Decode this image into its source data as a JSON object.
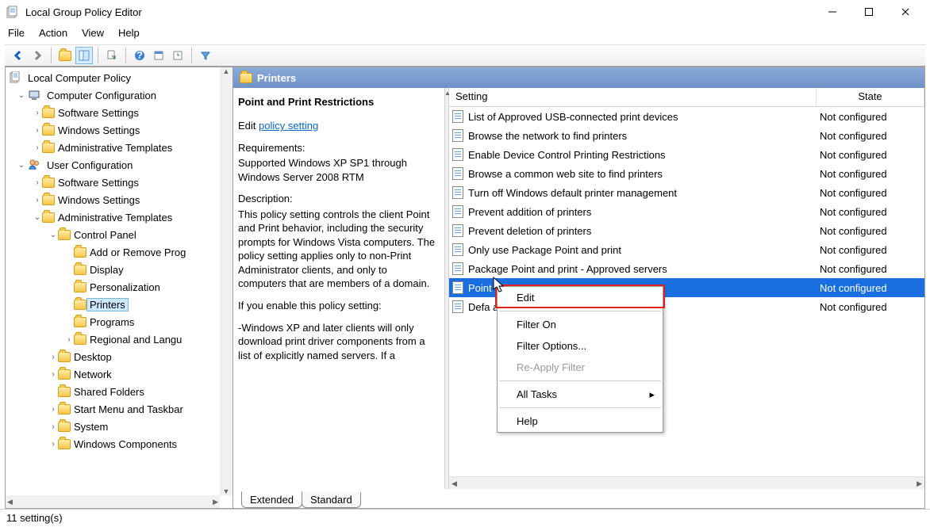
{
  "window": {
    "title": "Local Group Policy Editor"
  },
  "menubar": [
    "File",
    "Action",
    "View",
    "Help"
  ],
  "tree": {
    "root": "Local Computer Policy",
    "items": [
      {
        "depth": 0,
        "exp": "v",
        "icon": "computer",
        "label": "Computer Configuration"
      },
      {
        "depth": 1,
        "exp": ">",
        "icon": "folder",
        "label": "Software Settings"
      },
      {
        "depth": 1,
        "exp": ">",
        "icon": "folder",
        "label": "Windows Settings"
      },
      {
        "depth": 1,
        "exp": ">",
        "icon": "folder",
        "label": "Administrative Templates"
      },
      {
        "depth": 0,
        "exp": "v",
        "icon": "user",
        "label": "User Configuration"
      },
      {
        "depth": 1,
        "exp": ">",
        "icon": "folder",
        "label": "Software Settings"
      },
      {
        "depth": 1,
        "exp": ">",
        "icon": "folder",
        "label": "Windows Settings"
      },
      {
        "depth": 1,
        "exp": "v",
        "icon": "folder",
        "label": "Administrative Templates"
      },
      {
        "depth": 2,
        "exp": "v",
        "icon": "folder",
        "label": "Control Panel"
      },
      {
        "depth": 3,
        "exp": "",
        "icon": "folder",
        "label": "Add or Remove Prog"
      },
      {
        "depth": 3,
        "exp": "",
        "icon": "folder",
        "label": "Display"
      },
      {
        "depth": 3,
        "exp": "",
        "icon": "folder",
        "label": "Personalization"
      },
      {
        "depth": 3,
        "exp": "",
        "icon": "folder",
        "label": "Printers",
        "selected": true
      },
      {
        "depth": 3,
        "exp": "",
        "icon": "folder",
        "label": "Programs"
      },
      {
        "depth": 3,
        "exp": ">",
        "icon": "folder",
        "label": "Regional and Langu"
      },
      {
        "depth": 2,
        "exp": ">",
        "icon": "folder",
        "label": "Desktop"
      },
      {
        "depth": 2,
        "exp": ">",
        "icon": "folder",
        "label": "Network"
      },
      {
        "depth": 2,
        "exp": "",
        "icon": "folder",
        "label": "Shared Folders"
      },
      {
        "depth": 2,
        "exp": ">",
        "icon": "folder",
        "label": "Start Menu and Taskbar"
      },
      {
        "depth": 2,
        "exp": ">",
        "icon": "folder",
        "label": "System"
      },
      {
        "depth": 2,
        "exp": ">",
        "icon": "folder",
        "label": "Windows Components"
      }
    ]
  },
  "panel": {
    "header": "Printers",
    "title": "Point and Print Restrictions",
    "edit_prefix": "Edit",
    "edit_link": "policy setting",
    "req_label": "Requirements:",
    "req_text": "Supported Windows XP SP1 through Windows Server 2008 RTM",
    "desc_label": "Description:",
    "desc_text1": "This policy setting controls the client Point and Print behavior, including the security prompts for Windows Vista computers. The policy setting applies only to non-Print Administrator clients, and only to computers that are members of a domain.",
    "desc_text2": "    If you enable this policy setting:",
    "desc_text3": "    -Windows XP and later clients will only download print driver components from a list of explicitly named servers. If a"
  },
  "columns": {
    "setting": "Setting",
    "state": "State"
  },
  "settings": [
    {
      "name": "List of Approved USB-connected print devices",
      "state": "Not configured"
    },
    {
      "name": "Browse the network to find printers",
      "state": "Not configured"
    },
    {
      "name": "Enable Device Control Printing Restrictions",
      "state": "Not configured"
    },
    {
      "name": "Browse a common web site to find printers",
      "state": "Not configured"
    },
    {
      "name": "Turn off Windows default printer management",
      "state": "Not configured"
    },
    {
      "name": "Prevent addition of printers",
      "state": "Not configured"
    },
    {
      "name": "Prevent deletion of printers",
      "state": "Not configured"
    },
    {
      "name": "Only use Package Point and print",
      "state": "Not configured"
    },
    {
      "name": "Package Point and print - Approved servers",
      "state": "Not configured"
    },
    {
      "name": "Point",
      "state": "Not configured",
      "selected": true
    },
    {
      "name": "Defa                                                                       arching for printers",
      "state": "Not configured"
    }
  ],
  "ctxmenu": {
    "edit": "Edit",
    "filter_on": "Filter On",
    "filter_options": "Filter Options...",
    "reapply": "Re-Apply Filter",
    "all_tasks": "All Tasks",
    "help": "Help"
  },
  "tabs": {
    "extended": "Extended",
    "standard": "Standard"
  },
  "status": "11 setting(s)"
}
